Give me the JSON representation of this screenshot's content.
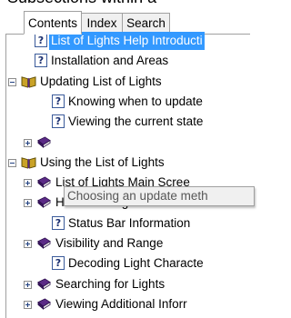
{
  "header_fragment": "Subsections within a",
  "tabs": [
    {
      "label": "Contents",
      "active": true
    },
    {
      "label": "Index",
      "active": false
    },
    {
      "label": "Search",
      "active": false
    }
  ],
  "tree": [
    {
      "label": "List of Lights Help Introducti",
      "icon": "page",
      "expander": "",
      "selected": true
    },
    {
      "label": "Installation and Areas",
      "icon": "page",
      "expander": "",
      "selected": false
    },
    {
      "label": "Updating List of Lights",
      "icon": "book-open",
      "expander": "minus",
      "selected": false
    },
    {
      "label": "Knowing when to update",
      "icon": "page",
      "expander": "",
      "selected": false
    },
    {
      "label": "Viewing the current state",
      "icon": "page",
      "expander": "",
      "selected": false
    },
    {
      "label": "",
      "icon": "book-closed",
      "expander": "plus",
      "selected": false
    },
    {
      "label": "Using the List of Lights",
      "icon": "book-open",
      "expander": "minus",
      "selected": false
    },
    {
      "label": "List of Lights Main Scree",
      "icon": "book-closed",
      "expander": "plus",
      "selected": false
    },
    {
      "label": "How to Navigate and Se",
      "icon": "book-closed",
      "expander": "plus",
      "selected": false
    },
    {
      "label": "Status Bar Information",
      "icon": "page",
      "expander": "",
      "selected": false
    },
    {
      "label": "Visibility and Range",
      "icon": "book-closed",
      "expander": "plus",
      "selected": false
    },
    {
      "label": "Decoding Light Characte",
      "icon": "page",
      "expander": "",
      "selected": false
    },
    {
      "label": "Searching for Lights",
      "icon": "book-closed",
      "expander": "plus",
      "selected": false
    },
    {
      "label": "Viewing Additional Inforr",
      "icon": "book-closed",
      "expander": "plus",
      "selected": false
    }
  ],
  "tooltip": "Choosing an update meth",
  "colors": {
    "selection": "#3399ff",
    "book": "#5b2a86",
    "book_open": "#c9a227"
  }
}
